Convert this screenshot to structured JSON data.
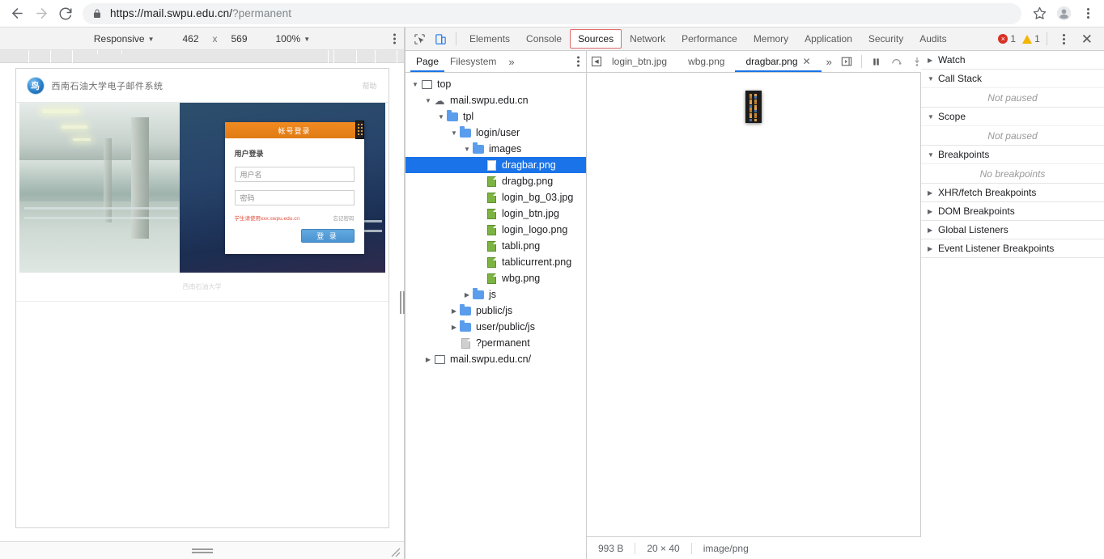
{
  "browser": {
    "back_icon": "back-arrow-icon",
    "forward_icon": "forward-arrow-icon",
    "reload_icon": "reload-icon",
    "lock_icon": "lock-icon",
    "url_scheme": "https://mail.swpu.edu.cn/",
    "url_query": "?permanent",
    "bookmark_icon": "star-icon",
    "profile_icon": "avatar-icon",
    "menu_icon": "kebab-menu-icon"
  },
  "device_toolbar": {
    "device_label": "Responsive",
    "width": "462",
    "times": "x",
    "height": "569",
    "zoom": "100%",
    "menu_icon": "kebab-menu-icon"
  },
  "emulated_page": {
    "logo_text": "鸟",
    "site_title": "西南石油大学电子邮件系统",
    "help_label": "帮助",
    "login": {
      "tab_label": "帐号登录",
      "form_title": "用户登录",
      "username_placeholder": "用户名",
      "password_placeholder": "密码",
      "warn_text": "学生请使用xxx.swpu.edu.cn",
      "forgot_label": "忘记密码",
      "submit_label": "登 录"
    },
    "footer_text": "西南石油大学"
  },
  "devtools": {
    "inspect_icon": "inspect-element-icon",
    "device_toggle_icon": "device-toolbar-icon",
    "tabs": [
      {
        "label": "Elements",
        "active": false
      },
      {
        "label": "Console",
        "active": false
      },
      {
        "label": "Sources",
        "active": true
      },
      {
        "label": "Network",
        "active": false
      },
      {
        "label": "Performance",
        "active": false
      },
      {
        "label": "Memory",
        "active": false
      },
      {
        "label": "Application",
        "active": false
      },
      {
        "label": "Security",
        "active": false
      },
      {
        "label": "Audits",
        "active": false
      }
    ],
    "error_count": "1",
    "warning_count": "1",
    "more_icon": "kebab-menu-icon",
    "close_icon": "close-icon",
    "accent_color": "#1a73e8",
    "active_tab_border": "#e06c6c"
  },
  "navigator": {
    "tabs": [
      {
        "label": "Page",
        "active": true
      },
      {
        "label": "Filesystem",
        "active": false
      }
    ],
    "more_label": "»",
    "menu_icon": "kebab-menu-icon",
    "tree": [
      {
        "label": "top",
        "indent": 0,
        "arrow": "down",
        "icon": "frame-icon",
        "selected": false
      },
      {
        "label": "mail.swpu.edu.cn",
        "indent": 1,
        "arrow": "down",
        "icon": "cloud-icon",
        "selected": false
      },
      {
        "label": "tpl",
        "indent": 2,
        "arrow": "down",
        "icon": "folder-icon",
        "selected": false
      },
      {
        "label": "login/user",
        "indent": 3,
        "arrow": "down",
        "icon": "folder-icon",
        "selected": false
      },
      {
        "label": "images",
        "indent": 4,
        "arrow": "down",
        "icon": "folder-icon",
        "selected": false
      },
      {
        "label": "dragbar.png",
        "indent": 5,
        "arrow": "none",
        "icon": "file-white-icon",
        "selected": true
      },
      {
        "label": "dragbg.png",
        "indent": 5,
        "arrow": "none",
        "icon": "file-green-icon",
        "selected": false
      },
      {
        "label": "login_bg_03.jpg",
        "indent": 5,
        "arrow": "none",
        "icon": "file-green-icon",
        "selected": false
      },
      {
        "label": "login_btn.jpg",
        "indent": 5,
        "arrow": "none",
        "icon": "file-green-icon",
        "selected": false
      },
      {
        "label": "login_logo.png",
        "indent": 5,
        "arrow": "none",
        "icon": "file-green-icon",
        "selected": false
      },
      {
        "label": "tabli.png",
        "indent": 5,
        "arrow": "none",
        "icon": "file-green-icon",
        "selected": false
      },
      {
        "label": "tablicurrent.png",
        "indent": 5,
        "arrow": "none",
        "icon": "file-green-icon",
        "selected": false
      },
      {
        "label": "wbg.png",
        "indent": 5,
        "arrow": "none",
        "icon": "file-green-icon",
        "selected": false
      },
      {
        "label": "js",
        "indent": 4,
        "arrow": "right",
        "icon": "folder-icon",
        "selected": false
      },
      {
        "label": "public/js",
        "indent": 3,
        "arrow": "right",
        "icon": "folder-icon",
        "selected": false
      },
      {
        "label": "user/public/js",
        "indent": 3,
        "arrow": "right",
        "icon": "folder-icon",
        "selected": false
      },
      {
        "label": "?permanent",
        "indent": 3,
        "arrow": "none",
        "icon": "file-grey-icon",
        "selected": false
      },
      {
        "label": "mail.swpu.edu.cn/",
        "indent": 1,
        "arrow": "right",
        "icon": "frame-icon",
        "selected": false
      }
    ]
  },
  "viewer": {
    "back_icon": "prev-tab-icon",
    "tabs": [
      {
        "label": "login_btn.jpg",
        "active": false,
        "closable": false
      },
      {
        "label": "wbg.png",
        "active": false,
        "closable": false
      },
      {
        "label": "dragbar.png",
        "active": true,
        "closable": true
      }
    ],
    "more_label": "»",
    "show_navigator_icon": "show-navigator-icon",
    "debug_buttons": [
      {
        "name": "pause-script-icon"
      },
      {
        "name": "step-over-icon"
      },
      {
        "name": "step-into-icon"
      },
      {
        "name": "step-out-icon"
      },
      {
        "name": "step-icon"
      },
      {
        "name": "deactivate-breakpoints-icon"
      },
      {
        "name": "pause-on-exceptions-icon"
      }
    ],
    "status": {
      "file_size": "993 B",
      "dimensions": "20 × 40",
      "mime_type": "image/png"
    },
    "image_name": "dragbar.png"
  },
  "debugger_panels": [
    {
      "label": "Watch",
      "expanded": false,
      "empty_text": null
    },
    {
      "label": "Call Stack",
      "expanded": true,
      "empty_text": "Not paused"
    },
    {
      "label": "Scope",
      "expanded": true,
      "empty_text": "Not paused"
    },
    {
      "label": "Breakpoints",
      "expanded": true,
      "empty_text": "No breakpoints"
    },
    {
      "label": "XHR/fetch Breakpoints",
      "expanded": false,
      "empty_text": null
    },
    {
      "label": "DOM Breakpoints",
      "expanded": false,
      "empty_text": null
    },
    {
      "label": "Global Listeners",
      "expanded": false,
      "empty_text": null
    },
    {
      "label": "Event Listener Breakpoints",
      "expanded": false,
      "empty_text": null
    }
  ]
}
